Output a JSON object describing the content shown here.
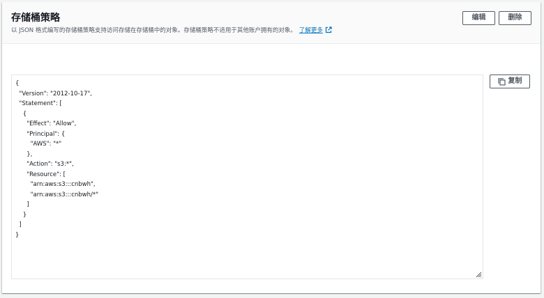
{
  "header": {
    "title": "存储桶策略",
    "description": "以 JSON 格式编写的存储桶策略支持访问存储在存储桶中的对象。存储桶策略不适用于其他账户拥有的对象。",
    "learn_more_label": "了解更多",
    "edit_label": "编辑",
    "delete_label": "删除"
  },
  "editor": {
    "copy_label": "复制",
    "lines": [
      "{",
      "  \"Version\": \"2012-10-17\",",
      "  \"Statement\": [",
      "    {",
      "      \"Effect\": \"Allow\",",
      "      \"Principal\": {",
      "        \"AWS\": \"*\"",
      "      },",
      "      \"Action\": \"s3:*\",",
      "      \"Resource\": [",
      "        \"arn:aws:s3:::cnbwh\",",
      "        \"arn:aws:s3:::cnbwh/*\"",
      "      ]",
      "    }",
      "  ]",
      "}"
    ]
  },
  "icons": {
    "external_link": "external-link-icon",
    "copy": "copy-icon",
    "resize": "resize-grip-icon"
  },
  "colors": {
    "link": "#0073bb",
    "button_border": "#545b64",
    "header_bg": "#fafafa"
  }
}
